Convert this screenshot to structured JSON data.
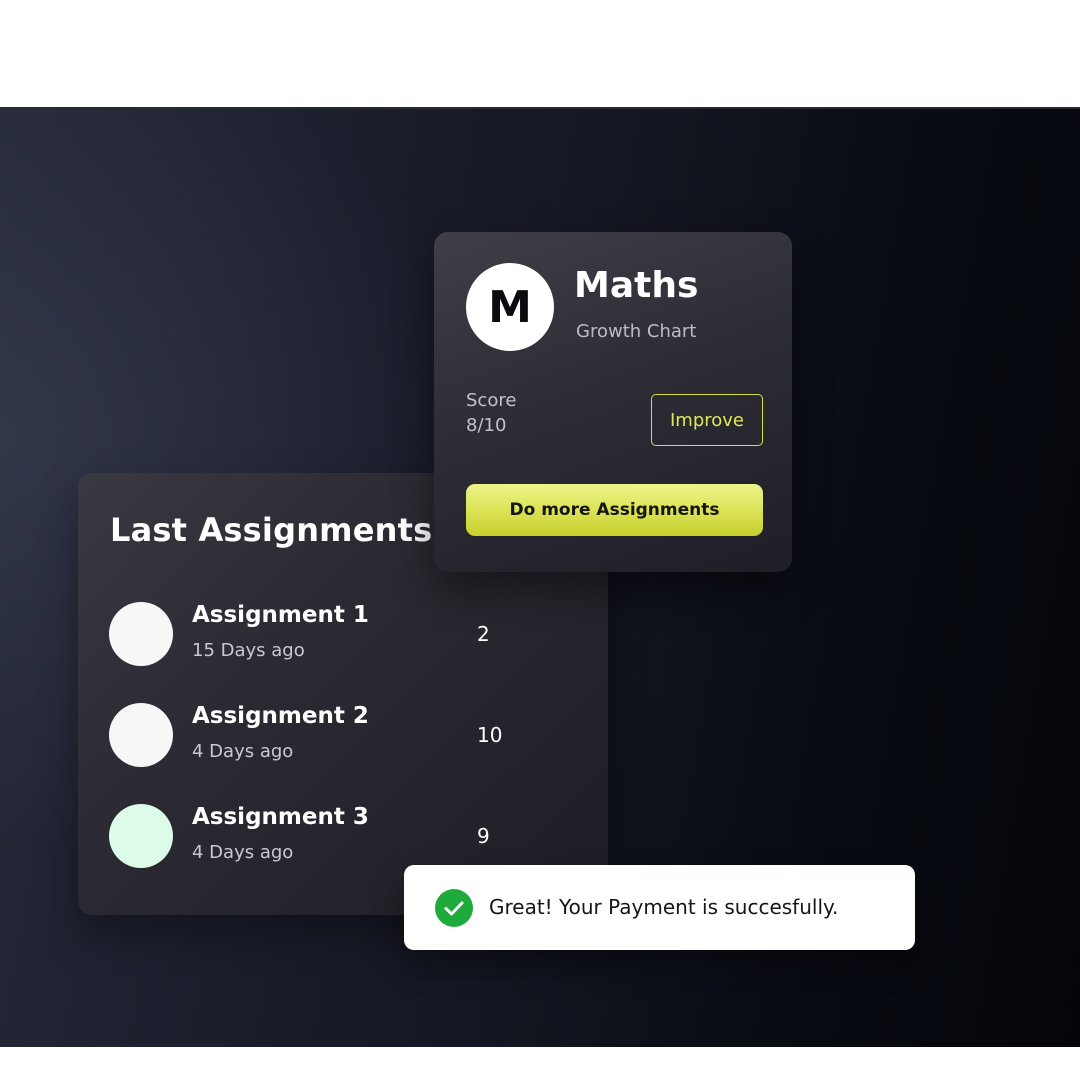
{
  "last_assignments": {
    "title": "Last Assignments",
    "items": [
      {
        "name": "Assignment 1",
        "ago": "15 Days ago",
        "score": "2",
        "dot_color": "#f7f7f8"
      },
      {
        "name": "Assignment 2",
        "ago": "4 Days ago",
        "score": "10",
        "dot_color": "#f7f7f8"
      },
      {
        "name": "Assignment 3",
        "ago": "4 Days ago",
        "score": "9",
        "dot_color": "#dcfbe9"
      }
    ]
  },
  "subject_card": {
    "avatar_letter": "M",
    "title": "Maths",
    "subtitle": "Growth Chart",
    "score_label": "Score",
    "score_value": "8/10",
    "improve_label": "Improve",
    "more_label": "Do more Assignments",
    "accent_color": "#d4dd3e"
  },
  "toast": {
    "icon": "check-circle-icon",
    "message": "Great! Your Payment is succesfully.",
    "icon_color": "#1eab3c"
  }
}
